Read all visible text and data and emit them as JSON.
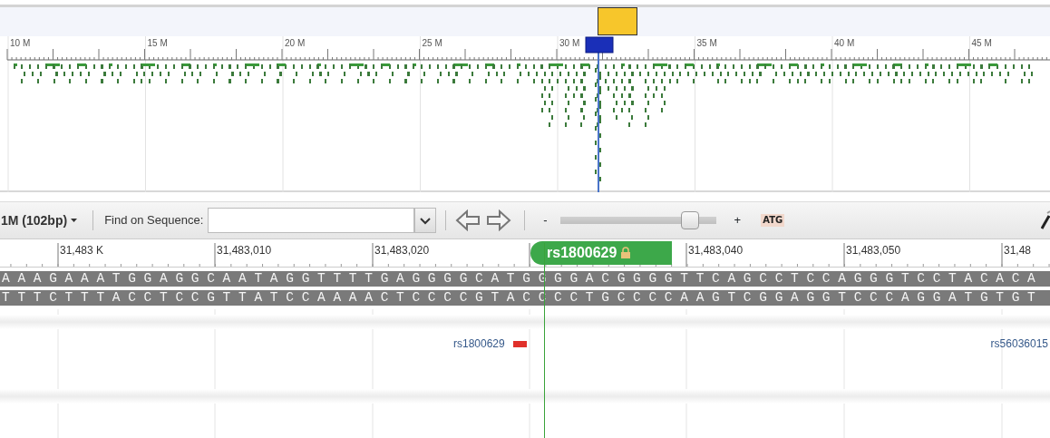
{
  "overview": {
    "axis_labels": [
      "10 M",
      "15 M",
      "20 M",
      "25 M",
      "30 M",
      "35 M",
      "40 M",
      "45 M"
    ]
  },
  "toolbar": {
    "zoom_menu": "1M (102bp)",
    "find_label": "Find on Sequence:",
    "zoom_out": "-",
    "zoom_slider": {
      "level": 0.88
    },
    "zoom_in": "+",
    "sequence_button": "ATG"
  },
  "sequence_ruler": {
    "labels": [
      "31,483 K",
      "31,483,010",
      "31,483,020",
      "31,483,040",
      "31,483,050",
      "31,48"
    ],
    "marker": {
      "label": "rs1800629"
    }
  },
  "sequence": {
    "forward": "AAAGAAATGGAGGCAATAGGTTTTGAGGGGCATGGGGACGGGGTTCAGCCTCCAGGGTCCTACACA",
    "reverse": "TTTCTTTACCTCCGTTATCCAAAACTCCCCGTACCCCTGCCCCAAGTCGGAGGTCCCAGGATGTGT"
  },
  "variation_track": {
    "features": [
      {
        "label": "rs1800629",
        "marked": true
      },
      {
        "label": "rs56036015",
        "marked": false
      }
    ]
  }
}
